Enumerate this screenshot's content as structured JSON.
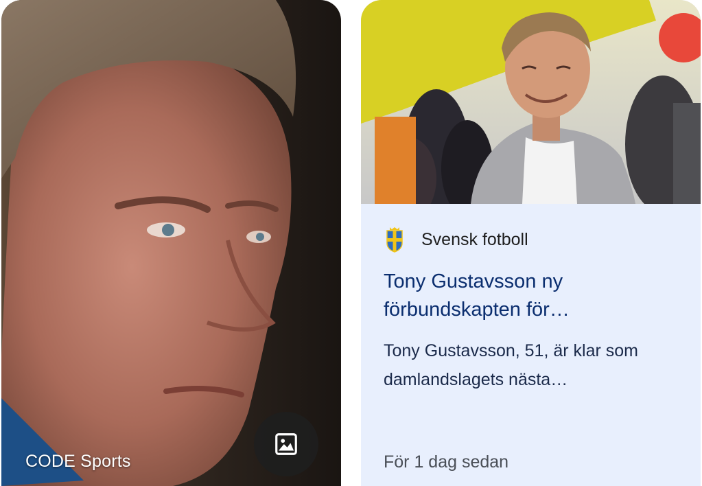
{
  "left_card": {
    "source": "CODE Sports",
    "image_icon": "image-icon"
  },
  "right_card": {
    "publisher": "Svensk fotboll",
    "publisher_logo": "swedish-crest-icon",
    "headline": "Tony Gustavsson ny förbundskapten för…",
    "snippet": "Tony Gustavsson, 51, är klar som damlandslagets nästa…",
    "time": "För 1 dag sedan"
  },
  "colors": {
    "card_background": "#e8effd",
    "headline": "#0b2e6f",
    "badge": "#1e1e1e"
  }
}
